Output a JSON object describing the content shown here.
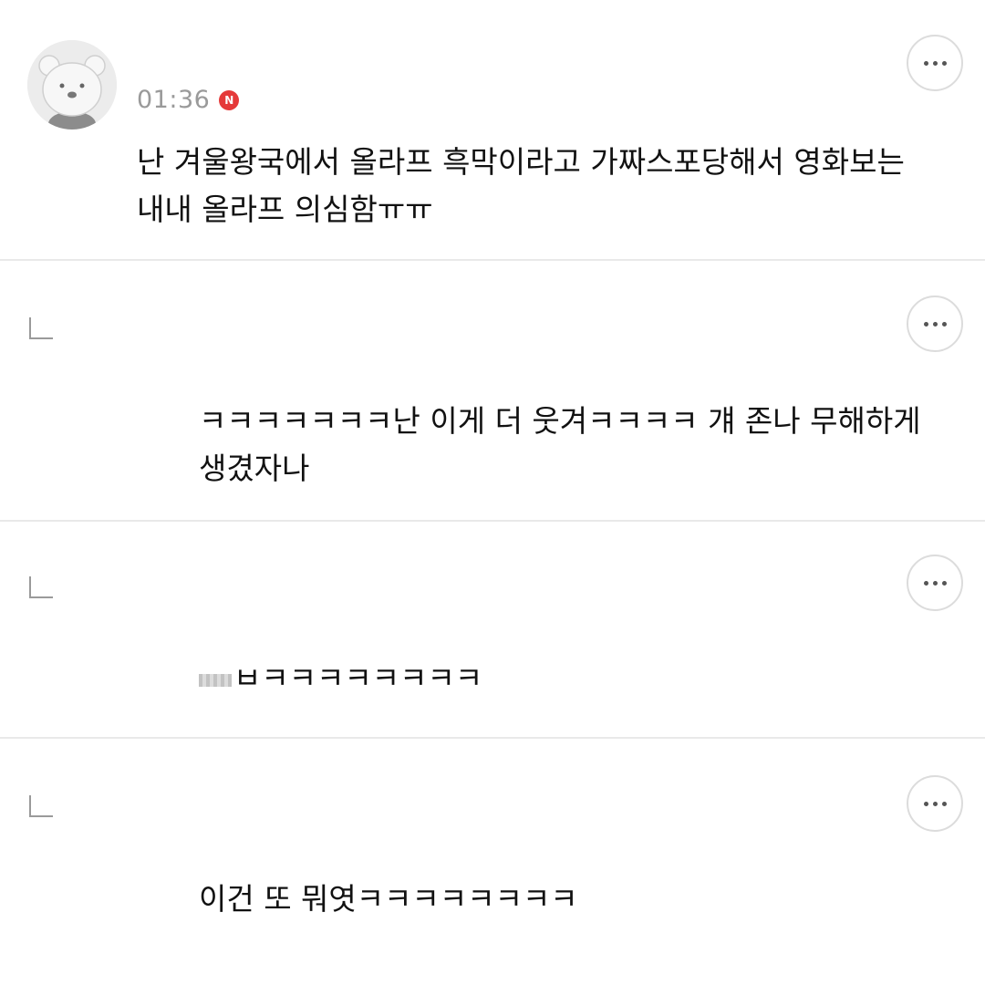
{
  "comments": [
    {
      "time": "01:36",
      "badge": "N",
      "text": "난 겨울왕국에서 올라프 흑막이라고 가짜스포당해서 영화보는 내내 올라프 의심함ㅠㅠ",
      "more_icon": "more-dots-icon",
      "avatar_icon": "bear-avatar-icon"
    }
  ],
  "replies": [
    {
      "text": "ㅋㅋㅋㅋㅋㅋㅋ난 이게 더 웃겨ㅋㅋㅋㅋ 걔 존나 무해하게 생겼자나",
      "icon": "reply-arrow-icon"
    },
    {
      "text": "ㅂㅋㅋㅋㅋㅋㅋㅋㅋ",
      "icon": "reply-arrow-icon"
    },
    {
      "text": "이건 또 뭐엿ㅋㅋㅋㅋㅋㅋㅋㅋ",
      "icon": "reply-arrow-icon"
    }
  ]
}
